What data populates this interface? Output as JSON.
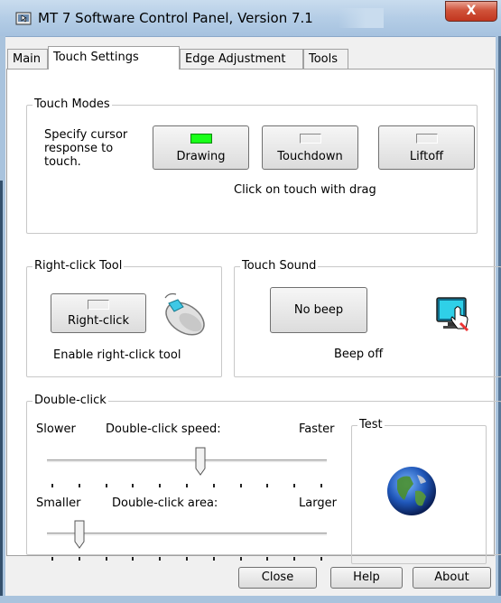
{
  "window": {
    "title": "MT 7 Software Control Panel, Version 7.1",
    "close_label": "X"
  },
  "tabs": [
    {
      "label": "Main",
      "active": false
    },
    {
      "label": "Touch Settings",
      "active": true
    },
    {
      "label": "Edge Adjustment",
      "active": false
    },
    {
      "label": "Tools",
      "active": false
    }
  ],
  "touch_modes": {
    "legend": "Touch Modes",
    "description": "Specify cursor\nresponse to\ntouch.",
    "buttons": [
      {
        "label": "Drawing",
        "indicator": "on"
      },
      {
        "label": "Touchdown",
        "indicator": "off"
      },
      {
        "label": "Liftoff",
        "indicator": "off"
      }
    ],
    "status": "Click on touch with drag"
  },
  "right_click_tool": {
    "legend": "Right-click Tool",
    "button_label": "Right-click",
    "status": "Enable right-click tool",
    "icon": "mouse-icon"
  },
  "touch_sound": {
    "legend": "Touch Sound",
    "button_label": "No beep",
    "status": "Beep off",
    "icon": "touch-monitor-icon"
  },
  "double_click": {
    "legend": "Double-click",
    "speed": {
      "label": "Double-click speed:",
      "min_label": "Slower",
      "max_label": "Faster",
      "value_fraction": 0.55,
      "tick_count": 11
    },
    "area": {
      "label": "Double-click area:",
      "min_label": "Smaller",
      "max_label": "Larger",
      "value_fraction": 0.1,
      "tick_count": 11
    },
    "test": {
      "legend": "Test",
      "icon": "globe-icon"
    }
  },
  "footer": {
    "close_label": "Close",
    "help_label": "Help",
    "about_label": "About"
  },
  "colors": {
    "indicator_on": "#19ff19",
    "titlebar": "#b4cde6",
    "close_button": "#c2361f"
  }
}
